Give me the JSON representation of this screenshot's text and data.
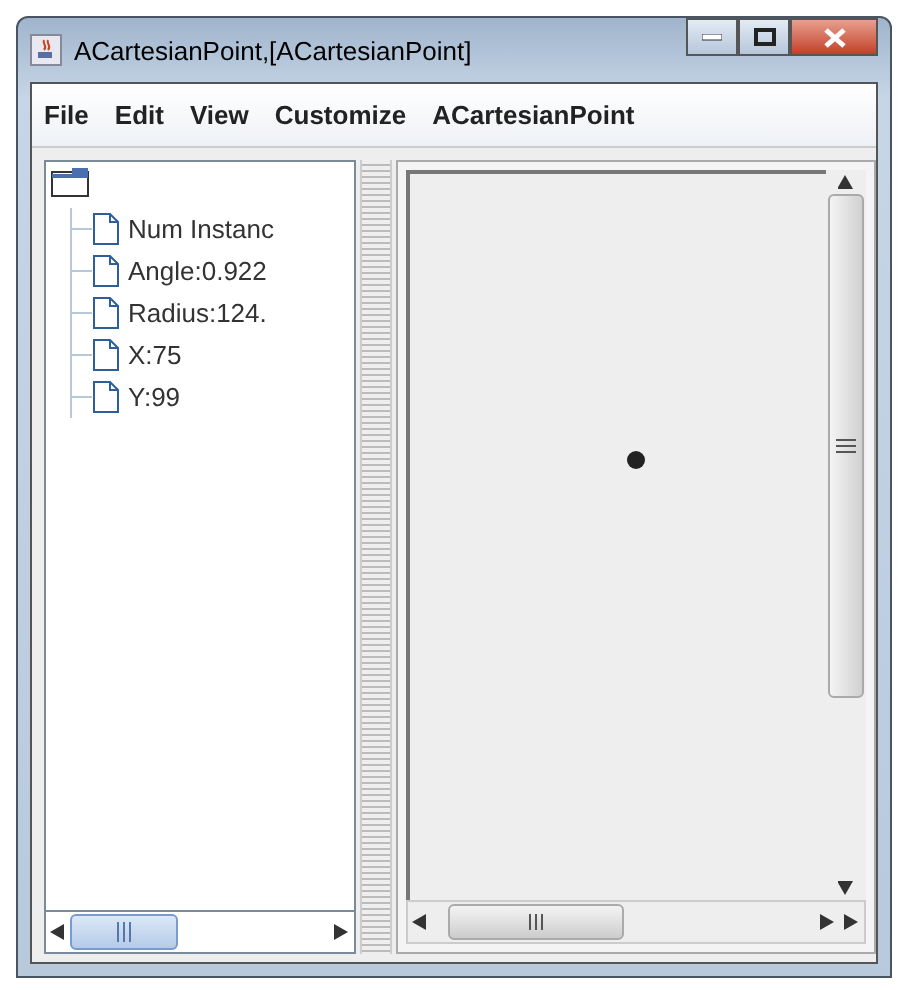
{
  "window": {
    "title": "ACartesianPoint,[ACartesianPoint]"
  },
  "menu": [
    "File",
    "Edit",
    "View",
    "Customize",
    "ACartesianPoint"
  ],
  "tree": {
    "expanded": true,
    "children": [
      {
        "label": "Num Instanc"
      },
      {
        "label": "Angle:0.922"
      },
      {
        "label": "Radius:124."
      },
      {
        "label": "X:75"
      },
      {
        "label": "Y:99"
      }
    ]
  }
}
